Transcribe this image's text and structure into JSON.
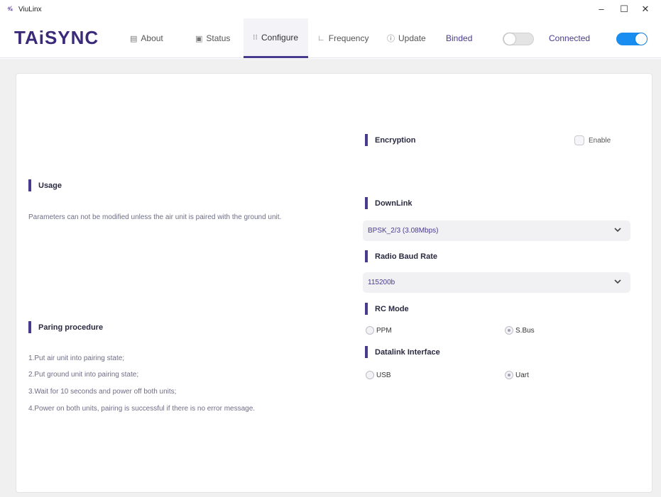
{
  "window": {
    "title": "ViuLinx",
    "icon": "viulinx-logo-icon"
  },
  "header": {
    "logo": "TAiSYNC",
    "tabs": [
      {
        "label": "About",
        "icon": "about-icon"
      },
      {
        "label": "Status",
        "icon": "status-icon"
      },
      {
        "label": "Configure",
        "icon": "sliders-icon",
        "active": true
      },
      {
        "label": "Frequency",
        "icon": "chart-icon"
      },
      {
        "label": "Update",
        "icon": "update-icon"
      }
    ],
    "binded_label": "Binded",
    "binded_on": false,
    "connected_label": "Connected",
    "connected_on": true
  },
  "left": {
    "usage_title": "Usage",
    "usage_text": "Parameters can not be modified unless the air unit is paired with the ground unit.",
    "pairing_title": "Paring procedure",
    "steps": [
      "1.Put air unit into pairing state;",
      "2.Put ground unit into pairing state;",
      "3.Wait for 10 seconds and power off both units;",
      "4.Power on both units, pairing is successful if there is no error message."
    ]
  },
  "right": {
    "encryption_title": "Encryption",
    "encryption_enable": "Enable",
    "downlink_title": "DownLink",
    "downlink_value": "BPSK_2/3 (3.08Mbps)",
    "baud_title": "Radio Baud Rate",
    "baud_value": "115200b",
    "rc_title": "RC Mode",
    "rc_options": [
      "PPM",
      "S.Bus"
    ],
    "rc_selected": "S.Bus",
    "datalink_title": "Datalink Interface",
    "datalink_options": [
      "USB",
      "Uart"
    ],
    "datalink_selected": "Uart"
  },
  "colors": {
    "accent": "#4a3a8f",
    "toggle_on": "#1a8ef0",
    "logo": "#3b2a7a"
  }
}
